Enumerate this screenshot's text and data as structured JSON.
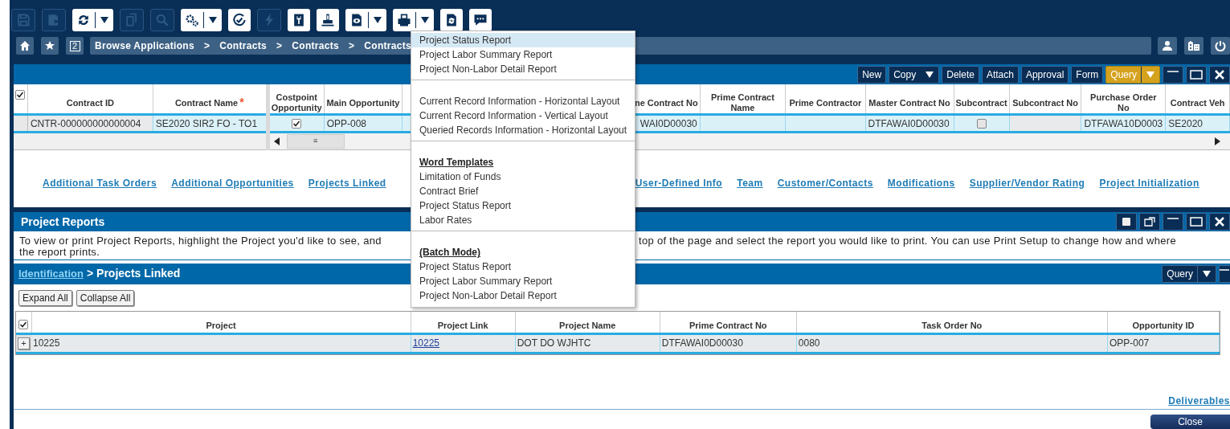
{
  "toolbar": [
    {
      "kind": "save",
      "disabled": true,
      "dropdown": false
    },
    {
      "kind": "save-as",
      "disabled": true,
      "dropdown": false
    },
    {
      "kind": "refresh",
      "disabled": false,
      "dropdown": true
    },
    {
      "kind": "copy",
      "disabled": true,
      "dropdown": false
    },
    {
      "kind": "search",
      "disabled": true,
      "dropdown": false
    },
    {
      "kind": "gears",
      "disabled": false,
      "dropdown": true
    },
    {
      "kind": "check",
      "disabled": false,
      "dropdown": false
    },
    {
      "kind": "lightning",
      "disabled": true,
      "dropdown": false
    },
    {
      "kind": "wrench",
      "disabled": false,
      "dropdown": false
    },
    {
      "kind": "stamp",
      "disabled": false,
      "dropdown": false
    },
    {
      "kind": "eye",
      "disabled": false,
      "dropdown": true
    },
    {
      "kind": "printer",
      "disabled": false,
      "dropdown": true
    },
    {
      "kind": "doc-refresh",
      "disabled": false,
      "dropdown": false
    },
    {
      "kind": "chat",
      "disabled": false,
      "dropdown": false
    }
  ],
  "nav": {
    "home_badge": "2",
    "breadcrumb": [
      "Browse Applications",
      "Contracts",
      "Contracts",
      "Contracts"
    ],
    "separator": ">"
  },
  "contracts": {
    "buttons": [
      {
        "label": "New",
        "kind": "plain"
      },
      {
        "label": "Copy",
        "kind": "dropdown"
      },
      {
        "label": "Delete",
        "kind": "plain"
      },
      {
        "label": "Attach",
        "kind": "plain"
      },
      {
        "label": "Approval",
        "kind": "plain"
      },
      {
        "label": "Form",
        "kind": "plain"
      },
      {
        "label": "Query",
        "kind": "query"
      }
    ],
    "select_all": true,
    "columns": [
      {
        "label": "Contract ID"
      },
      {
        "label": "Contract Name",
        "required_mark": "*"
      },
      {
        "label": "Costpoint Opportunity"
      },
      {
        "label": "Main Opportunity"
      },
      {
        "label": "ne Contract No"
      },
      {
        "label": "Prime Contract Name"
      },
      {
        "label": "Prime Contractor"
      },
      {
        "label": "Master Contract No"
      },
      {
        "label": "Subcontract"
      },
      {
        "label": "Subcontract No"
      },
      {
        "label": "Purchase Order No"
      },
      {
        "label": "Contract Veh"
      }
    ],
    "row": {
      "selected": true,
      "cells": [
        {
          "kind": "text",
          "text": "CNTR-000000000000004",
          "locked": true
        },
        {
          "kind": "text",
          "text": "SE2020 SIR2 FO - TO1",
          "locked": false
        },
        {
          "kind": "checkbox",
          "checked": true
        },
        {
          "kind": "text",
          "text": "OPP-008",
          "locked": false
        },
        {
          "kind": "text",
          "text": "WAI0D00030",
          "locked": false
        },
        {
          "kind": "blank",
          "locked": false
        },
        {
          "kind": "blank",
          "locked": false
        },
        {
          "kind": "text",
          "text": "DTFAWAI0D00030",
          "locked": false
        },
        {
          "kind": "checkbox",
          "checked": false
        },
        {
          "kind": "blank",
          "locked": true
        },
        {
          "kind": "text",
          "text": "DTFAWA10D0003",
          "locked": false
        },
        {
          "kind": "text",
          "text": "SE2020",
          "locked": false
        }
      ]
    },
    "scroll_thumb": "≡",
    "links": [
      "Additional Task Orders",
      "Additional Opportunities",
      "Projects Linked",
      "User-Defined Info",
      "Team",
      "Customer/Contacts",
      "Modifications",
      "Supplier/Vendor Rating",
      "Project Initialization"
    ]
  },
  "reports": {
    "title": "Project Reports",
    "description_start": "To view or print Project Reports, highlight the Project you'd like to see, and",
    "description_end": "top of the page and select the report you would like to print. You can use Print Setup to change how and where",
    "description_line2": "the report prints."
  },
  "linked": {
    "crumb_link": "Identification",
    "crumb_sep": ">",
    "title": "Projects Linked",
    "query": "Query",
    "buttons": [
      "Expand All",
      "Collapse All"
    ],
    "select_all": true,
    "columns": [
      "Project",
      "Project Link",
      "Project Name",
      "Prime Contract No",
      "Task Order No",
      "Opportunity ID"
    ],
    "rows": [
      {
        "expand": "+",
        "cells": [
          "10225",
          "10225",
          "DOT DO WJHTC",
          "DTFAWAI0D00030",
          "0080",
          "OPP-007"
        ]
      }
    ],
    "footer_link": "Deliverables",
    "close": "Close"
  },
  "menu": {
    "groups": [
      {
        "items": [
          {
            "label": "Project Status Report",
            "selected": true
          },
          {
            "label": "Project Labor Summary Report",
            "selected": false
          },
          {
            "label": "Project Non-Labor Detail Report",
            "selected": false
          }
        ]
      },
      {
        "items": [
          {
            "label": "Current Record Information - Horizontal Layout",
            "selected": false
          },
          {
            "label": "Current Record Information - Vertical Layout",
            "selected": false
          },
          {
            "label": "Queried Records Information - Horizontal Layout",
            "selected": false
          }
        ]
      },
      {
        "heading": "Word Templates",
        "items": [
          {
            "label": "Limitation of Funds",
            "selected": false
          },
          {
            "label": "Contract Brief",
            "selected": false
          },
          {
            "label": "Project Status Report",
            "selected": false
          },
          {
            "label": "Labor Rates",
            "selected": false
          }
        ]
      },
      {
        "heading": "(Batch Mode)",
        "items": [
          {
            "label": "Project Status Report",
            "selected": false
          },
          {
            "label": "Project Labor Summary Report",
            "selected": false
          },
          {
            "label": "Project Non-Labor Detail Report",
            "selected": false
          }
        ]
      }
    ]
  }
}
